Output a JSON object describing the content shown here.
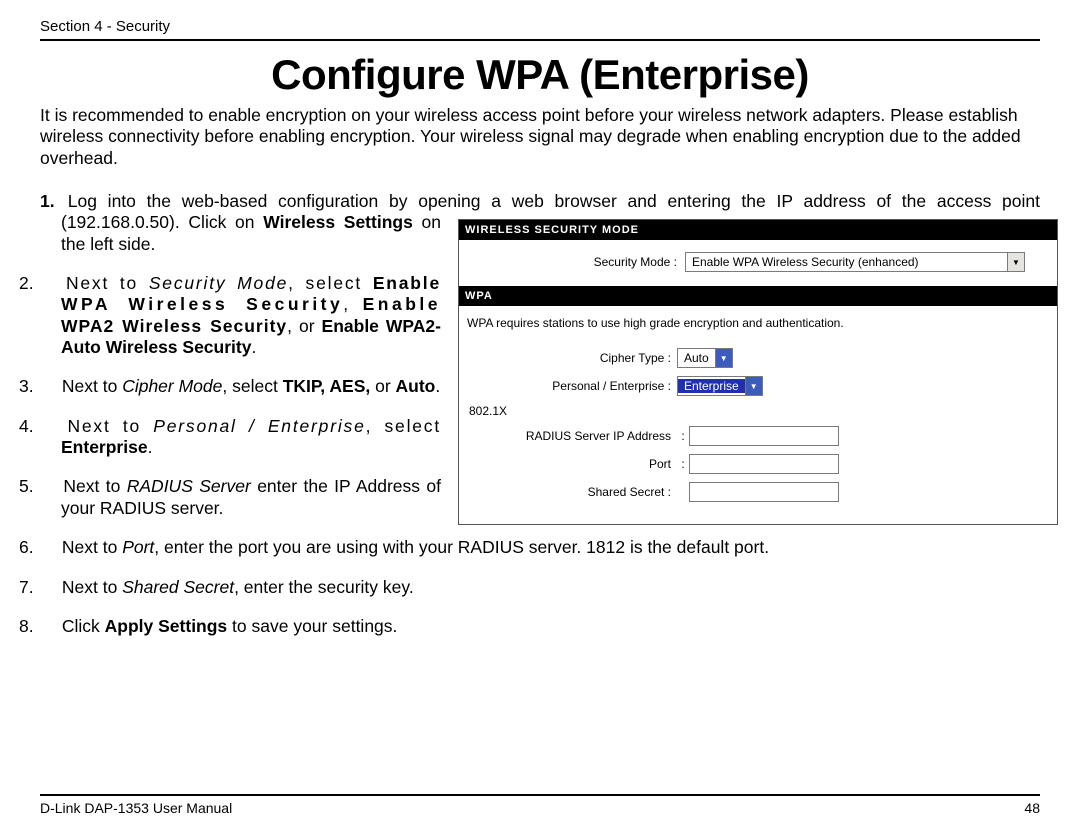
{
  "header": "Section 4 - Security",
  "footer_left": "D-Link DAP-1353 User Manual",
  "footer_right": "48",
  "title": "Configure WPA (Enterprise)",
  "intro": "It is recommended to enable encryption on your wireless access point before your wireless network adapters. Please establish wireless connectivity before enabling encryption. Your wireless signal may degrade when enabling encryption due to the added overhead.",
  "steps": {
    "s1a": "Log into the web-based configuration by opening a web browser and entering the IP address of the access point",
    "s1b_pre": "(192.168.0.50).  Click on ",
    "s1b_bold": "Wireless Settings",
    "s1b_post": " on the left side.",
    "s2_pre": "Next to ",
    "s2_i": "Security Mode",
    "s2_mid": ", select ",
    "s2_b1": "Enable WPA Wireless Security",
    "s2_sep1": ", ",
    "s2_b2": "Enable WPA2 Wireless Security",
    "s2_sep2": ", or ",
    "s2_b3": "Enable WPA2-Auto Wireless Security",
    "s2_end": ".",
    "s3_pre": "Next to ",
    "s3_i": "Cipher Mode",
    "s3_mid": ", select ",
    "s3_b": "TKIP, AES,",
    "s3_mid2": " or ",
    "s3_b2": "Auto",
    "s3_end": ".",
    "s4_pre": "Next to ",
    "s4_i": "Personal / Enterprise",
    "s4_mid": ", select ",
    "s4_b": "Enterprise",
    "s4_end": ".",
    "s5_pre": "Next to ",
    "s5_i": "RADIUS Server",
    "s5_post": " enter the IP Address of your RADIUS server.",
    "s6_pre": "Next to ",
    "s6_i": "Port",
    "s6_post": ", enter the port you are using with your RADIUS server. 1812 is the default port.",
    "s7_pre": "Next to ",
    "s7_i": "Shared Secret",
    "s7_post": ", enter the security key.",
    "s8_pre": "Click ",
    "s8_b": "Apply Settings",
    "s8_post": " to save your settings."
  },
  "figure": {
    "bar1": "WIRELESS SECURITY MODE",
    "sec_mode_label": "Security Mode :",
    "sec_mode_value": "Enable WPA Wireless Security (enhanced)",
    "bar2": "WPA",
    "desc": "WPA requires stations to use high grade encryption and authentication.",
    "cipher_label": "Cipher Type :",
    "cipher_value": "Auto",
    "pe_label": "Personal / Enterprise :",
    "pe_value": "Enterprise",
    "sub": "802.1X",
    "radius_label": "RADIUS Server  IP Address",
    "port_label": "Port",
    "secret_label": "Shared Secret :"
  }
}
